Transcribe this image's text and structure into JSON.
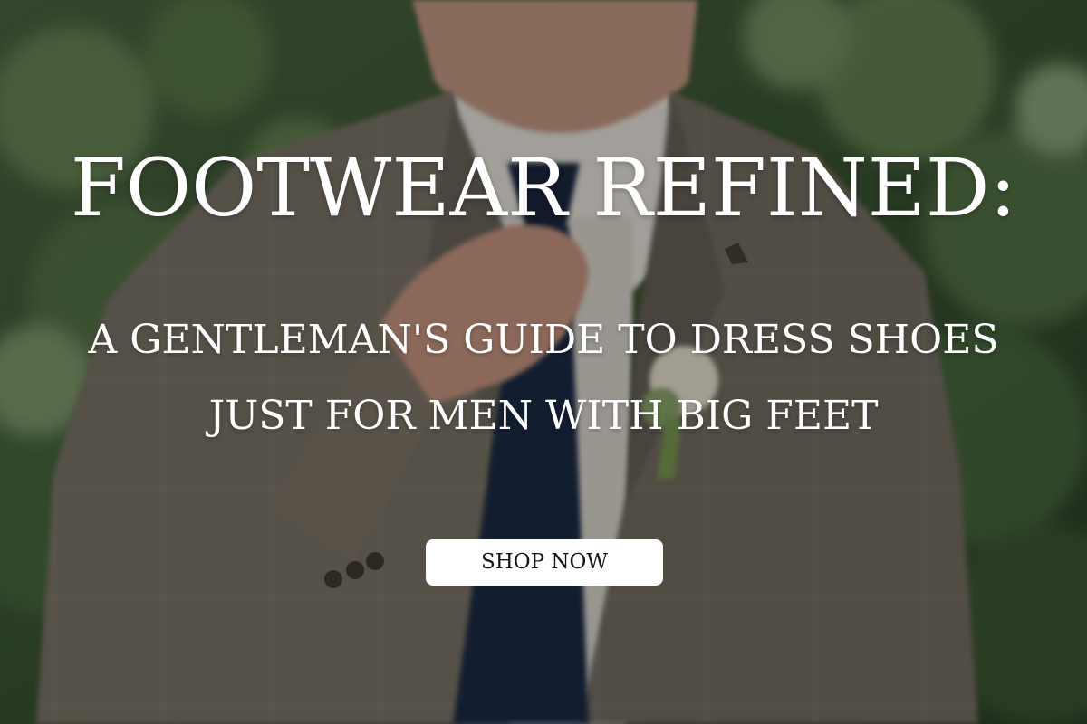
{
  "hero": {
    "headline": "FOOTWEAR REFINED:",
    "subhead_line1": "A GENTLEMAN'S GUIDE TO DRESS SHOES",
    "subhead_line2": "JUST FOR MEN WITH BIG FEET",
    "cta_label": "SHOP NOW"
  },
  "colors": {
    "text": "#ffffff",
    "button_bg": "#ffffff",
    "button_text": "#151515",
    "foliage": "#3e5a32",
    "suit": "#7b7266",
    "tie": "#1e2a44"
  }
}
